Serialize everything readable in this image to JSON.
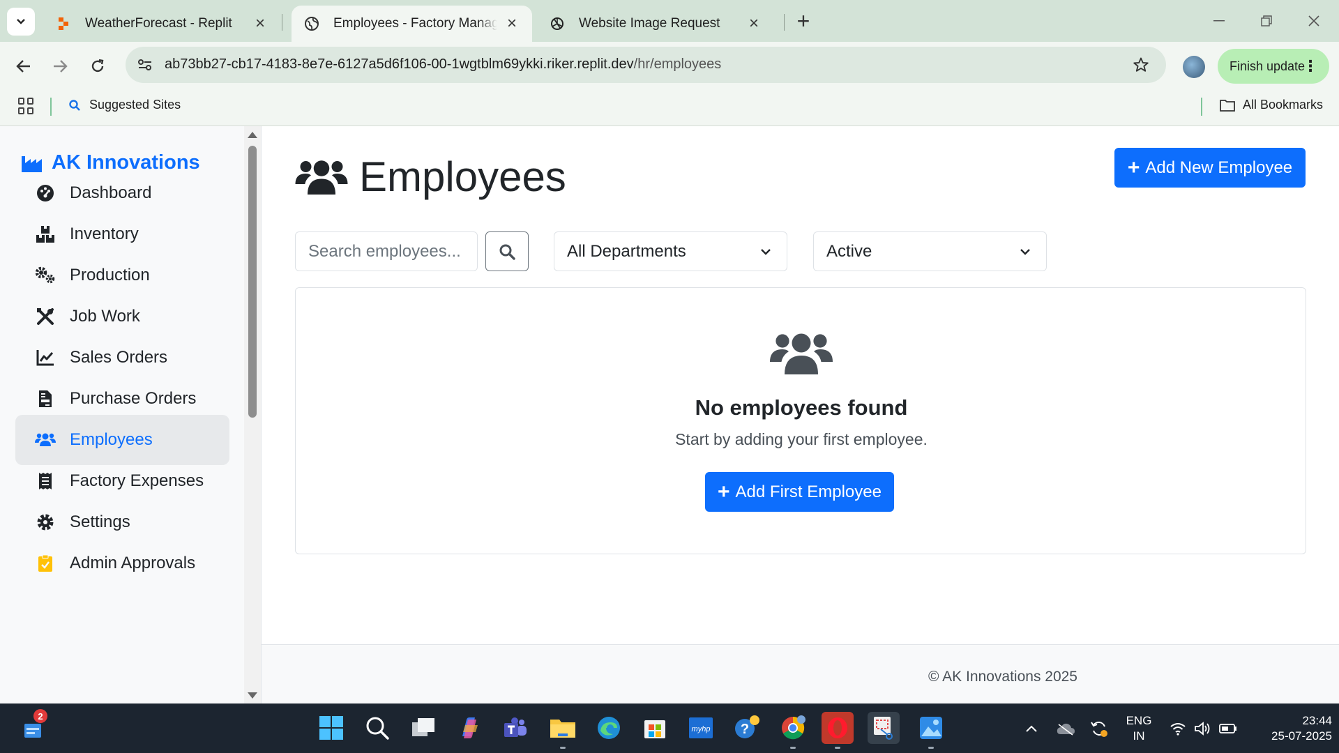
{
  "browser": {
    "tabs": [
      {
        "title": "WeatherForecast - Replit",
        "active": false
      },
      {
        "title": "Employees - Factory Manageme",
        "active": true
      },
      {
        "title": "Website Image Request",
        "active": false
      }
    ],
    "url_main": "ab73bb27-cb17-4183-8e7e-6127a5d6f106-00-1wgtblm69ykki.riker.replit.dev",
    "url_path": "/hr/employees",
    "finish_update": "Finish update",
    "bookmarks": {
      "suggested_sites": "Suggested Sites",
      "all_bookmarks": "All Bookmarks"
    }
  },
  "sidebar": {
    "brand": "AK Innovations",
    "items": [
      {
        "label": "Dashboard",
        "icon": "palette-icon"
      },
      {
        "label": "Inventory",
        "icon": "boxes-icon"
      },
      {
        "label": "Production",
        "icon": "gears-icon"
      },
      {
        "label": "Job Work",
        "icon": "tools-icon"
      },
      {
        "label": "Sales Orders",
        "icon": "chart-line-icon"
      },
      {
        "label": "Purchase Orders",
        "icon": "file-invoice-icon"
      },
      {
        "label": "Employees",
        "icon": "users-icon",
        "active": true
      },
      {
        "label": "Factory Expenses",
        "icon": "receipt-icon"
      },
      {
        "label": "Settings",
        "icon": "gear-icon"
      },
      {
        "label": "Admin Approvals",
        "icon": "clipboard-check-icon"
      }
    ]
  },
  "main": {
    "title": "Employees",
    "add_new_label": "Add New Employee",
    "search_placeholder": "Search employees...",
    "department_filter": "All Departments",
    "status_filter": "Active",
    "empty": {
      "title": "No employees found",
      "subtitle": "Start by adding your first employee.",
      "button": "Add First Employee"
    }
  },
  "footer": {
    "text": "© AK Innovations 2025"
  },
  "taskbar": {
    "notification_count": "2",
    "lang_line1": "ENG",
    "lang_line2": "IN",
    "time": "23:44",
    "date": "25-07-2025"
  },
  "colors": {
    "primary": "#0d6efd",
    "tabbar": "#d3e3d7",
    "finish_update_bg": "#b8eeb5",
    "taskbar": "#1c2530"
  }
}
